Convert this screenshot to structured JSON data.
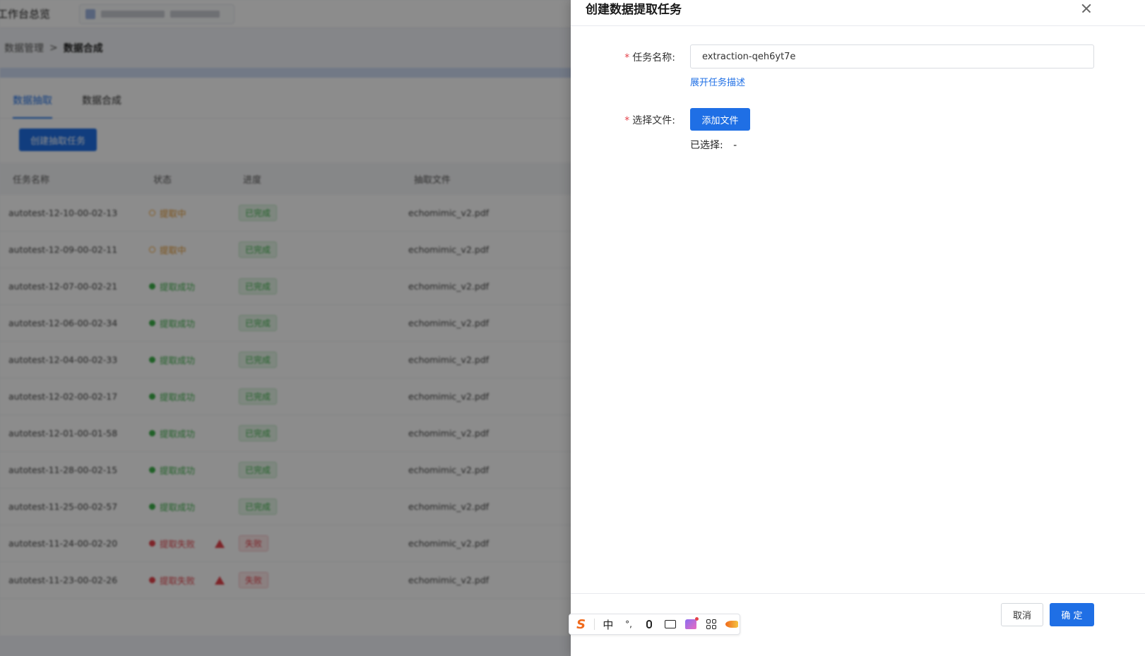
{
  "background": {
    "workspace_title": "工作台总览",
    "breadcrumb": {
      "parent": "数据管理",
      "separator": ">",
      "current": "数据合成"
    },
    "tabs": [
      {
        "label": "数据抽取",
        "active": true
      },
      {
        "label": "数据合成",
        "active": false
      }
    ],
    "create_button": "创建抽取任务",
    "table": {
      "headers": [
        "任务名称",
        "状态",
        "进度",
        "抽取文件"
      ],
      "rows": [
        {
          "name": "autotest-12-10-00-02-13",
          "status": "提取中",
          "status_type": "running",
          "progress": "已完成",
          "file": "echomimic_v2.pdf"
        },
        {
          "name": "autotest-12-09-00-02-11",
          "status": "提取中",
          "status_type": "running",
          "progress": "已完成",
          "file": "echomimic_v2.pdf"
        },
        {
          "name": "autotest-12-07-00-02-21",
          "status": "提取成功",
          "status_type": "success",
          "progress": "已完成",
          "file": "echomimic_v2.pdf"
        },
        {
          "name": "autotest-12-06-00-02-34",
          "status": "提取成功",
          "status_type": "success",
          "progress": "已完成",
          "file": "echomimic_v2.pdf"
        },
        {
          "name": "autotest-12-04-00-02-33",
          "status": "提取成功",
          "status_type": "success",
          "progress": "已完成",
          "file": "echomimic_v2.pdf"
        },
        {
          "name": "autotest-12-02-00-02-17",
          "status": "提取成功",
          "status_type": "success",
          "progress": "已完成",
          "file": "echomimic_v2.pdf"
        },
        {
          "name": "autotest-12-01-00-01-58",
          "status": "提取成功",
          "status_type": "success",
          "progress": "已完成",
          "file": "echomimic_v2.pdf"
        },
        {
          "name": "autotest-11-28-00-02-15",
          "status": "提取成功",
          "status_type": "success",
          "progress": "已完成",
          "file": "echomimic_v2.pdf"
        },
        {
          "name": "autotest-11-25-00-02-57",
          "status": "提取成功",
          "status_type": "success",
          "progress": "已完成",
          "file": "echomimic_v2.pdf"
        },
        {
          "name": "autotest-11-24-00-02-20",
          "status": "提取失败",
          "status_type": "fail",
          "progress": "失败",
          "file": "echomimic_v2.pdf"
        },
        {
          "name": "autotest-11-23-00-02-26",
          "status": "提取失败",
          "status_type": "fail",
          "progress": "失败",
          "file": "echomimic_v2.pdf"
        }
      ]
    }
  },
  "drawer": {
    "title": "创建数据提取任务",
    "fields": {
      "task_name_label": "任务名称:",
      "task_name_value": "extraction-qeh6yt7e",
      "expand_description_link": "展开任务描述",
      "select_file_label": "选择文件:",
      "add_file_button": "添加文件",
      "selected_label": "已选择:",
      "selected_value": "-"
    },
    "footer": {
      "cancel_button": "取消",
      "confirm_button": "确 定"
    }
  },
  "ime_toolbar": {
    "logo": "S",
    "mode": "中",
    "punct": "°,"
  },
  "colors": {
    "primary": "#1f6fe5",
    "success": "#3db04a",
    "running": "#e0932a",
    "danger": "#e5434b"
  }
}
